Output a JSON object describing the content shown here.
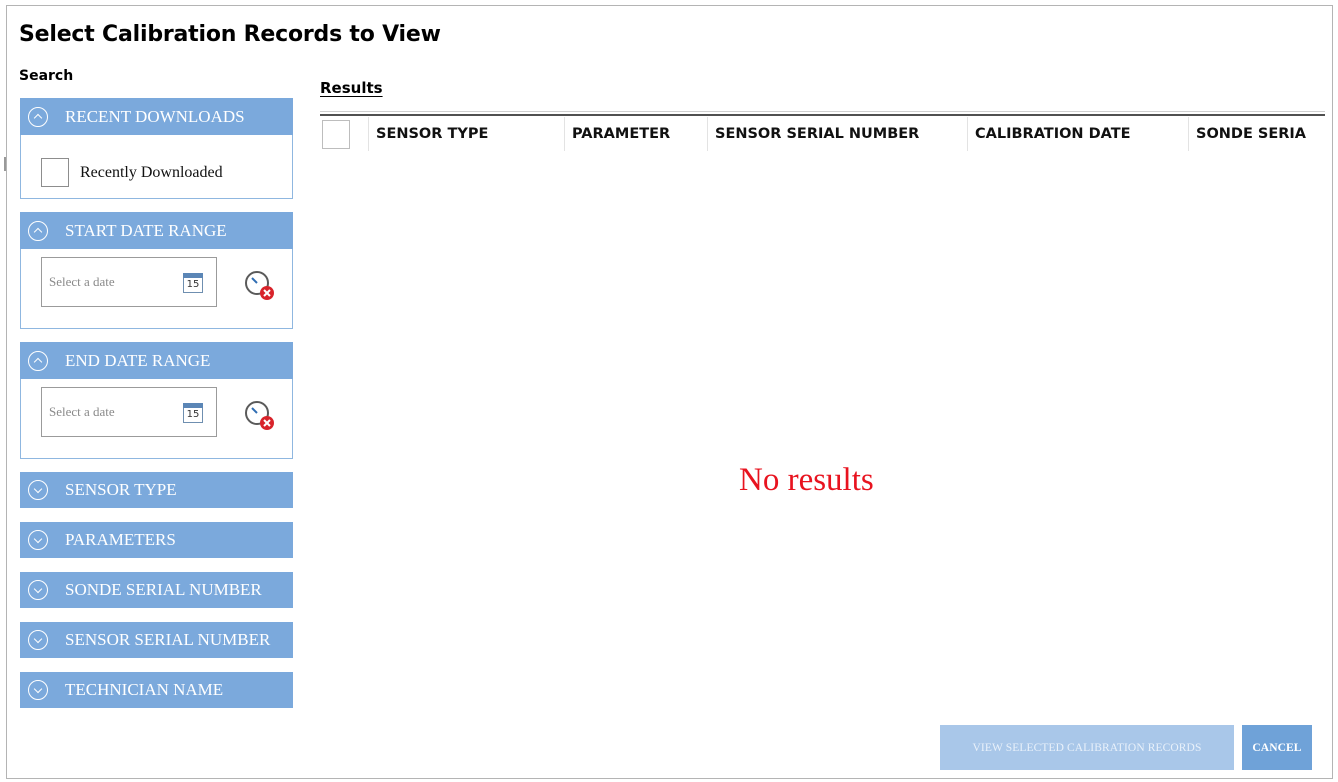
{
  "dialog": {
    "title": "Select Calibration Records to View",
    "search_label": "Search",
    "results_label": "Results"
  },
  "filters": {
    "recent_downloads": {
      "label": "RECENT DOWNLOADS",
      "expanded": true,
      "checkbox_label": "Recently Downloaded",
      "checked": false
    },
    "start_date_range": {
      "label": "START DATE RANGE",
      "expanded": true,
      "placeholder": "Select a date",
      "calendar_day": "15"
    },
    "end_date_range": {
      "label": "END DATE RANGE",
      "expanded": true,
      "placeholder": "Select a date",
      "calendar_day": "15"
    },
    "sensor_type": {
      "label": "SENSOR TYPE",
      "expanded": false
    },
    "parameters": {
      "label": "PARAMETERS",
      "expanded": false
    },
    "sonde_serial_number": {
      "label": "SONDE SERIAL NUMBER",
      "expanded": false
    },
    "sensor_serial_number": {
      "label": "SENSOR SERIAL NUMBER",
      "expanded": false
    },
    "technician_name": {
      "label": "TECHNICIAN NAME",
      "expanded": false
    }
  },
  "results_table": {
    "columns": [
      "SENSOR TYPE",
      "PARAMETER",
      "SENSOR SERIAL NUMBER",
      "CALIBRATION DATE",
      "SONDE SERIA"
    ],
    "rows": [],
    "empty_message": "No results"
  },
  "buttons": {
    "view_selected": "VIEW SELECTED CALIBRATION RECORDS",
    "cancel": "CANCEL"
  },
  "colors": {
    "section_header": "#7ba9dc",
    "no_results_text": "#e8131f",
    "button_primary": "#6fa2d8",
    "button_disabled": "#a9c7e9"
  },
  "icons": {
    "expanded_chevron": "chevron-up-circle-icon",
    "collapsed_chevron": "chevron-down-circle-icon",
    "calendar": "calendar-icon",
    "clear_date": "clear-date-icon"
  }
}
